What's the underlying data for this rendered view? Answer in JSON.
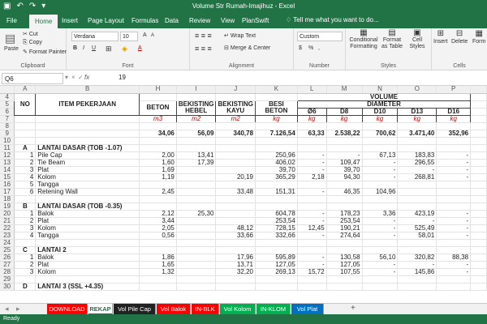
{
  "window": {
    "title": "Volume Str Rumah-Imajihuz - Excel"
  },
  "ribbon_tabs": [
    "File",
    "Home",
    "Insert",
    "Page Layout",
    "Formulas",
    "Data",
    "Review",
    "View",
    "PlanSwift"
  ],
  "tell_me": "Tell me what you want to do...",
  "ribbon": {
    "clipboard": {
      "paste": "Paste",
      "cut": "Cut",
      "copy": "Copy",
      "format_painter": "Format Painter",
      "label": "Clipboard"
    },
    "font": {
      "name": "Verdana",
      "size": "10",
      "bold": "B",
      "italic": "I",
      "underline": "U",
      "grow": "A",
      "shrink": "A",
      "font_color": "A",
      "label": "Font"
    },
    "alignment": {
      "wrap": "Wrap Text",
      "merge": "Merge & Center",
      "label": "Alignment"
    },
    "number": {
      "format": "Custom",
      "currency": "$",
      "percent": "%",
      "comma": ",",
      "label": "Number"
    },
    "styles": {
      "conditional": "Conditional Formatting",
      "format_table": "Format as Table",
      "cell_styles": "Cell Styles",
      "label": "Styles"
    },
    "cells": {
      "insert": "Insert",
      "delete": "Delete",
      "format": "Form",
      "label": "Cells"
    }
  },
  "formula_bar": {
    "name_box": "Q6",
    "fx": "fx",
    "value": "19"
  },
  "columns": [
    "",
    "A",
    "B",
    "H",
    "I",
    "J",
    "K",
    "L",
    "M",
    "N",
    "O",
    "P",
    ""
  ],
  "grid": {
    "header": {
      "no": "NO",
      "item": "ITEM PEKERJAAN",
      "beton": "BETON",
      "hebel": "BEKISTING HEBEL",
      "kayu": "BEKISTING KAYU",
      "besi": "BESI BETON",
      "volume": "VOLUME",
      "diameter": "DIAMETER",
      "d0": "Ø6",
      "d8": "D8",
      "d10": "D10",
      "d13": "D13",
      "d16": "D16"
    },
    "units": [
      "m3",
      "m2",
      "m2",
      "kg",
      "kg",
      "kg",
      "kg",
      "kg",
      "kg"
    ],
    "totals": [
      "34,06",
      "56,09",
      "340,78",
      "7.126,54",
      "63,33",
      "2.538,22",
      "700,62",
      "3.471,40",
      "352,96"
    ],
    "rows": [
      {
        "r": "11",
        "a": "A",
        "no": "",
        "item": "LANTAI DASAR (TOB -1.07)",
        "sec": true,
        "v": [
          "",
          "",
          "",
          "",
          "",
          "",
          "",
          "",
          ""
        ]
      },
      {
        "r": "12",
        "a": "",
        "no": "1",
        "item": "Pile Cap",
        "v": [
          "2,00",
          "13,41",
          "",
          "250,96",
          "-",
          "-",
          "67,13",
          "183,83",
          "-"
        ]
      },
      {
        "r": "13",
        "a": "",
        "no": "2",
        "item": "Tie Beam",
        "v": [
          "1,60",
          "17,39",
          "",
          "406,02",
          "-",
          "109,47",
          "-",
          "296,55",
          "-"
        ]
      },
      {
        "r": "14",
        "a": "",
        "no": "3",
        "item": "Plat",
        "v": [
          "1,69",
          "",
          "",
          "39,70",
          "-",
          "39,70",
          "-",
          "-",
          "-"
        ]
      },
      {
        "r": "15",
        "a": "",
        "no": "4",
        "item": "Kolom",
        "v": [
          "1,19",
          "",
          "20,19",
          "365,29",
          "2,18",
          "94,30",
          "-",
          "268,81",
          "-"
        ]
      },
      {
        "r": "16",
        "a": "",
        "no": "5",
        "item": "Tangga",
        "v": [
          "",
          "",
          "",
          "",
          "",
          "",
          "",
          "",
          ""
        ]
      },
      {
        "r": "17",
        "a": "",
        "no": "6",
        "item": "Retening Wall",
        "v": [
          "2,45",
          "",
          "33,48",
          "151,31",
          "-",
          "46,35",
          "104,96",
          "",
          ""
        ]
      },
      {
        "r": "18",
        "a": "",
        "no": "",
        "item": "",
        "v": [
          "",
          "",
          "",
          "",
          "",
          "",
          "",
          "",
          ""
        ]
      },
      {
        "r": "19",
        "a": "B",
        "no": "",
        "item": "LANTAI DASAR (TOB -0.35)",
        "sec": true,
        "v": [
          "",
          "",
          "",
          "",
          "",
          "",
          "",
          "",
          ""
        ]
      },
      {
        "r": "20",
        "a": "",
        "no": "1",
        "item": "Balok",
        "v": [
          "2,12",
          "25,30",
          "",
          "604,78",
          "-",
          "178,23",
          "3,36",
          "423,19",
          "-"
        ]
      },
      {
        "r": "21",
        "a": "",
        "no": "2",
        "item": "Plat",
        "v": [
          "3,44",
          "",
          "",
          "253,54",
          "-",
          "253,54",
          "-",
          "-",
          "-"
        ]
      },
      {
        "r": "22",
        "a": "",
        "no": "3",
        "item": "Kolom",
        "v": [
          "2,05",
          "",
          "48,12",
          "728,15",
          "12,45",
          "190,21",
          "-",
          "525,49",
          "-"
        ]
      },
      {
        "r": "23",
        "a": "",
        "no": "4",
        "item": "Tangga",
        "v": [
          "0,56",
          "",
          "33,66",
          "332,66",
          "-",
          "274,64",
          "-",
          "58,01",
          "-"
        ]
      },
      {
        "r": "24",
        "a": "",
        "no": "",
        "item": "",
        "v": [
          "",
          "",
          "",
          "",
          "",
          "",
          "",
          "",
          ""
        ]
      },
      {
        "r": "25",
        "a": "C",
        "no": "",
        "item": "LANTAI 2",
        "sec": true,
        "v": [
          "",
          "",
          "",
          "",
          "",
          "",
          "",
          "",
          ""
        ]
      },
      {
        "r": "26",
        "a": "",
        "no": "1",
        "item": "Balok",
        "v": [
          "1,86",
          "",
          "17,96",
          "595,89",
          "-",
          "130,58",
          "56,10",
          "320,82",
          "88,38"
        ]
      },
      {
        "r": "27",
        "a": "",
        "no": "2",
        "item": "Plat",
        "v": [
          "1,65",
          "",
          "13,71",
          "127,05",
          "-",
          "127,05",
          "-",
          "-",
          "-"
        ]
      },
      {
        "r": "28",
        "a": "",
        "no": "3",
        "item": "Kolom",
        "v": [
          "1,32",
          "",
          "32,20",
          "269,13",
          "15,72",
          "107,55",
          "-",
          "145,86",
          "-"
        ]
      },
      {
        "r": "29",
        "a": "",
        "no": "",
        "item": "",
        "v": [
          "",
          "",
          "",
          "",
          "",
          "",
          "",
          "",
          ""
        ]
      },
      {
        "r": "30",
        "a": "D",
        "no": "",
        "item": "LANTAI 3 (SSL +4.35)",
        "sec": true,
        "v": [
          "",
          "",
          "",
          "",
          "",
          "",
          "",
          "",
          ""
        ]
      }
    ]
  },
  "sheet_tabs": [
    {
      "label": "DOWNLOAD",
      "bg": "#ff0000",
      "fg": "#ffffff"
    },
    {
      "label": "REKAP",
      "bg": "#ffffff",
      "fg": "#217346"
    },
    {
      "label": "Vol Pile Cap",
      "bg": "#222222",
      "fg": "#ffffff"
    },
    {
      "label": "Vol Balok",
      "bg": "#ff0000",
      "fg": "#ffffff"
    },
    {
      "label": "IN-BLK",
      "bg": "#ff0000",
      "fg": "#ffffff"
    },
    {
      "label": "Vol Kolom",
      "bg": "#00b050",
      "fg": "#ffffff"
    },
    {
      "label": "IN-KLOM",
      "bg": "#00b050",
      "fg": "#ffffff"
    },
    {
      "label": "Vol Plat",
      "bg": "#0070c0",
      "fg": "#ffffff"
    }
  ],
  "add_sheet": "+",
  "status": "Ready"
}
